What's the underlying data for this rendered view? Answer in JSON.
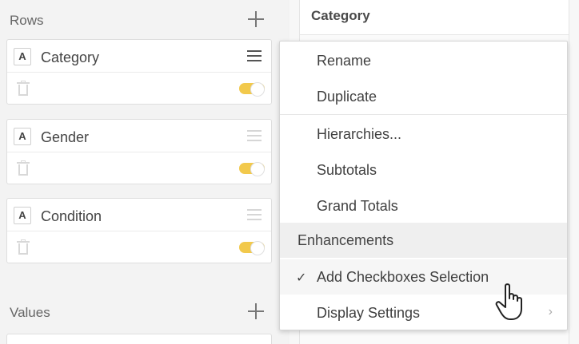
{
  "rows_section": {
    "title": "Rows",
    "fields": [
      {
        "type_glyph": "A",
        "label": "Category",
        "toggle_on": true
      },
      {
        "type_glyph": "A",
        "label": "Gender",
        "toggle_on": true
      },
      {
        "type_glyph": "A",
        "label": "Condition",
        "toggle_on": true
      }
    ]
  },
  "values_section": {
    "title": "Values"
  },
  "right_panel": {
    "title": "Category"
  },
  "context_menu": {
    "items_group1": [
      "Rename",
      "Duplicate"
    ],
    "items_group2": [
      "Hierarchies...",
      "Subtotals",
      "Grand Totals"
    ],
    "enhancements_header": "Enhancements",
    "checked_item": {
      "label": "Add Checkboxes Selection",
      "checked": true,
      "check_glyph": "✓"
    },
    "submenu_item": {
      "label": "Display Settings",
      "chevron_glyph": "›"
    }
  },
  "colors": {
    "toggle_accent": "#f2c94c",
    "menu_header_bg": "#efefef"
  }
}
